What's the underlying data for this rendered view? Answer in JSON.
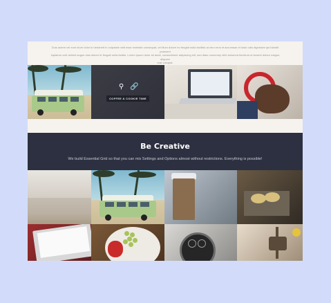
{
  "intro": {
    "line1": "Duis autem vel eum iriure dolor in hendrerit in vulputate velit esse molestie consequat, vel illum dolore eu feugiat nulla facilisis at vero eros et accumsan et iusto odio dignissim qui blandit praesent",
    "line2": "luptatum zzril delenit augue duis dolore te feugait nulla facilisi. Lorem ipsum dolor sit amet, consectetuer adipiscing elit, sed diam nonummy nibh euismod tincidunt ut laoreet dolore magna aliquam",
    "line3": "erat volutpat."
  },
  "hover_tile": {
    "label": "COFFEE & COOKIE TIME",
    "icons": [
      "search-icon",
      "link-icon"
    ]
  },
  "banner": {
    "title": "Be Creative",
    "subtitle": "We build Essential Grid so that you can mix Settings and Options almost without restrictions. Everything is possible!"
  },
  "colors": {
    "page_bg": "#d2dcfa",
    "card_bg": "#f6f3ee",
    "banner_bg": "#2c3040"
  }
}
